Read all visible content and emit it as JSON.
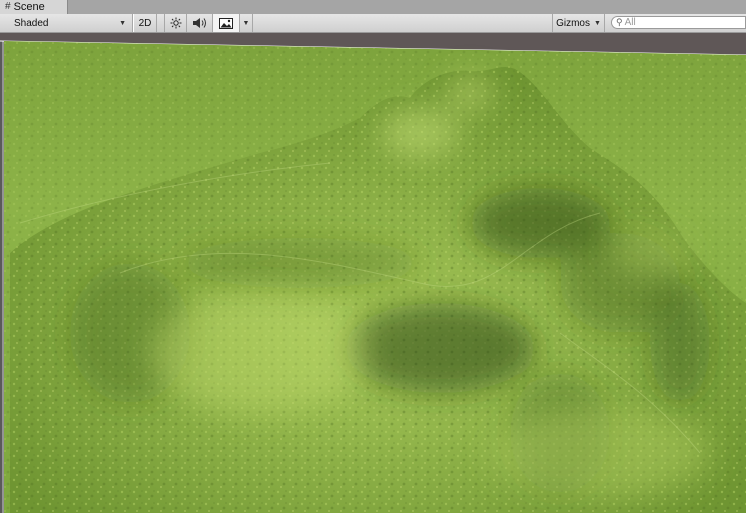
{
  "window": {
    "tab": {
      "label": "Scene",
      "icon": "scene-grid-icon"
    }
  },
  "toolbar": {
    "draw_mode": {
      "value": "Shaded",
      "icon": "dropdown-caret-icon"
    },
    "mode_2d": "2D",
    "scene_lighting_icon": "sun-icon",
    "scene_audio_icon": "speaker-icon",
    "scene_effects_icon": "image-icon",
    "gizmos": {
      "label": "Gizmos",
      "icon": "dropdown-caret-icon"
    },
    "search": {
      "placeholder": "All",
      "icon": "search-icon"
    }
  },
  "scene": {
    "content": "terrain",
    "colors": {
      "sky": "#5f5757",
      "grass_light": "#9cc24f",
      "grass_dark": "#3d5a1f",
      "edge_white": "#ffffff"
    }
  }
}
